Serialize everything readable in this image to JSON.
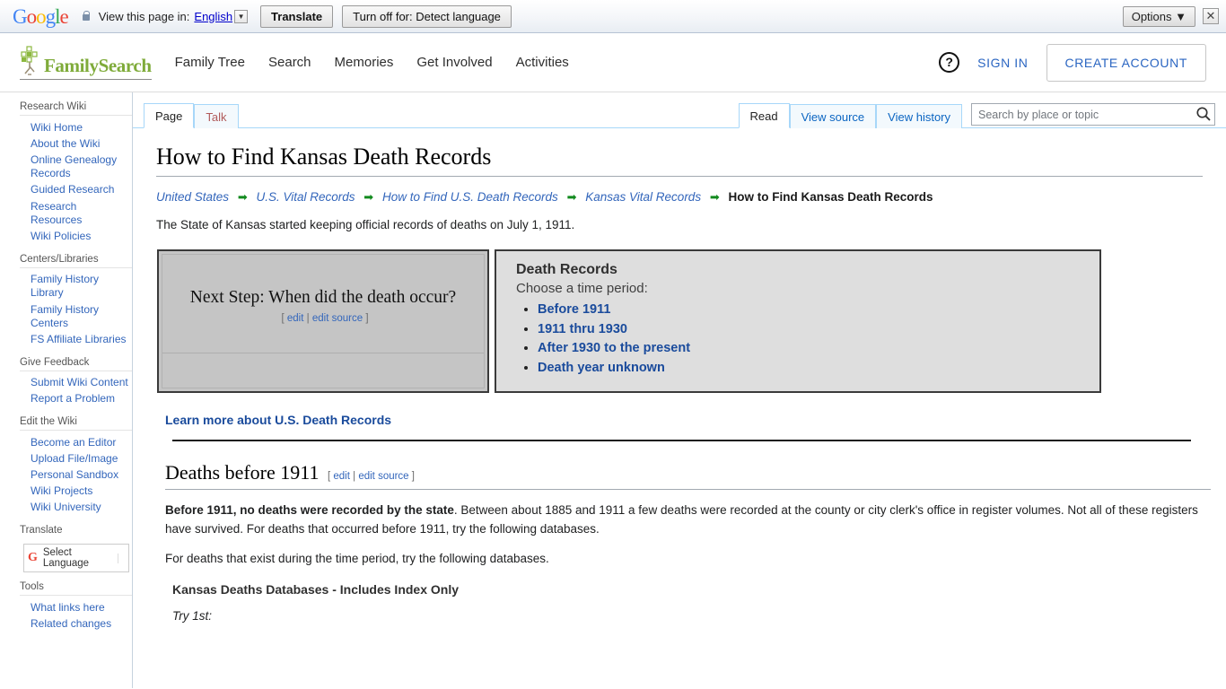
{
  "translate_bar": {
    "logo": "Google",
    "lock_icon": "lock-icon",
    "view_text": "View this page in:",
    "language": "English",
    "caret": "▼",
    "translate_button": "Translate",
    "turnoff_button": "Turn off for: Detect language",
    "options_button": "Options ▼",
    "close_icon": "✕"
  },
  "site_header": {
    "brand": "FamilySearch",
    "nav": [
      {
        "label": "Family Tree"
      },
      {
        "label": "Search"
      },
      {
        "label": "Memories"
      },
      {
        "label": "Get Involved"
      },
      {
        "label": "Activities"
      }
    ],
    "help_icon": "?",
    "sign_in": "SIGN IN",
    "create_account": "CREATE ACCOUNT"
  },
  "sidebar": {
    "sections": [
      {
        "title": "Research Wiki",
        "items": [
          {
            "label": "Wiki Home"
          },
          {
            "label": "About the Wiki"
          },
          {
            "label": "Online Genealogy Records"
          },
          {
            "label": "Guided Research"
          },
          {
            "label": "Research Resources"
          },
          {
            "label": "Wiki Policies"
          }
        ]
      },
      {
        "title": "Centers/Libraries",
        "items": [
          {
            "label": "Family History Library"
          },
          {
            "label": "Family History Centers"
          },
          {
            "label": "FS Affiliate Libraries"
          }
        ]
      },
      {
        "title": "Give Feedback",
        "items": [
          {
            "label": "Submit Wiki Content"
          },
          {
            "label": "Report a Problem"
          }
        ]
      },
      {
        "title": "Edit the Wiki",
        "items": [
          {
            "label": "Become an Editor"
          },
          {
            "label": "Upload File/Image"
          },
          {
            "label": "Personal Sandbox"
          },
          {
            "label": "Wiki Projects"
          },
          {
            "label": "Wiki University"
          }
        ]
      }
    ],
    "translate_title": "Translate",
    "language_widget": {
      "icon": "google-g-icon",
      "label": "Select Language"
    },
    "tools_title": "Tools",
    "tools_items": [
      {
        "label": "What links here"
      },
      {
        "label": "Related changes"
      }
    ]
  },
  "tabs": {
    "left": [
      {
        "label": "Page",
        "state": "selected"
      },
      {
        "label": "Talk",
        "state": "unselected"
      }
    ],
    "right": [
      {
        "label": "Read",
        "state": "selected"
      },
      {
        "label": "View source",
        "state": "link"
      },
      {
        "label": "View history",
        "state": "link"
      }
    ]
  },
  "search": {
    "placeholder": "Search by place or topic",
    "value": "",
    "icon": "search-icon"
  },
  "article": {
    "title": "How to Find Kansas Death Records",
    "breadcrumb": {
      "arrow": "➡",
      "links": [
        "United States",
        "U.S. Vital Records",
        "How to Find U.S. Death Records",
        "Kansas Vital Records"
      ],
      "current": "How to Find Kansas Death Records"
    },
    "intro": "The State of Kansas started keeping official records of deaths on July 1, 1911.",
    "next_step_box": {
      "title": "Next Step: When did the death occur?",
      "edit_open": "[",
      "edit": "edit",
      "edit_sep": "|",
      "edit_source": "edit source",
      "edit_close": "]"
    },
    "death_records_box": {
      "title": "Death Records",
      "subtitle": "Choose a time period:",
      "links": [
        "Before 1911",
        "1911 thru 1930",
        "After 1930 to the present",
        "Death year unknown"
      ]
    },
    "learn_more": "Learn more about U.S. Death Records",
    "section": {
      "heading": "Deaths before 1911",
      "edit_open": "[",
      "edit": "edit",
      "edit_sep": "|",
      "edit_source": "edit source",
      "edit_close": "]",
      "para1_bold": "Before 1911, no deaths were recorded by the state",
      "para1_rest": ". Between about 1885 and 1911 a few deaths were recorded at the county or city clerk's office in register volumes. Not all of these registers have survived. For deaths that occurred before 1911, try the following databases.",
      "para2": "For deaths that exist during the time period, try the following databases.",
      "subheading": "Kansas Deaths Databases - Includes Index Only",
      "try_line": "Try 1st:"
    }
  },
  "colors": {
    "brand_green": "#7fab3a",
    "link_blue": "#3366bb",
    "bold_link_blue": "#1a4b9c",
    "tab_border": "#a7d7f9",
    "breadcrumb_arrow_green": "#128a1e",
    "box_left_bg": "#c5c5c5",
    "box_right_bg": "#dedede"
  }
}
